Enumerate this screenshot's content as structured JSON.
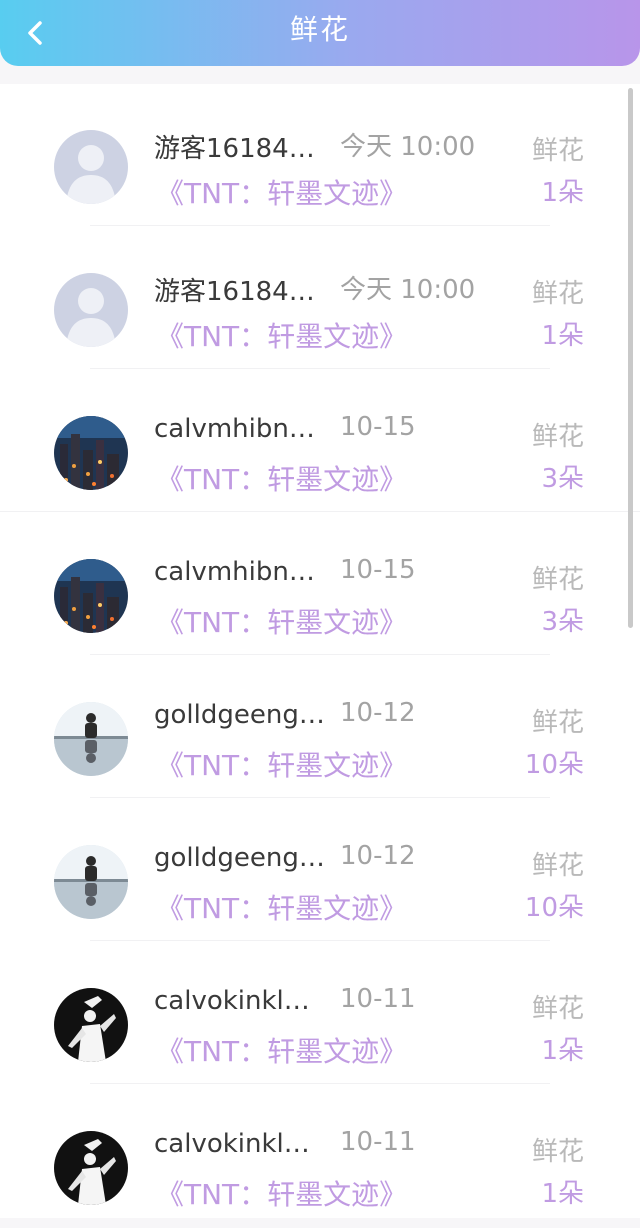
{
  "header": {
    "title": "鲜花",
    "back_icon": "chevron-left-icon"
  },
  "colors": {
    "accent": "#c09be2",
    "gradient_start": "#58cdf0",
    "gradient_end": "#b895ea"
  },
  "items": [
    {
      "name": "游客16184…",
      "time": "今天 10:00",
      "kind": "鲜花",
      "book": "《TNT：轩墨文迹》",
      "count": "1朵",
      "avatar": "default-avatar"
    },
    {
      "name": "游客16184…",
      "time": "今天 10:00",
      "kind": "鲜花",
      "book": "《TNT：轩墨文迹》",
      "count": "1朵",
      "avatar": "default-avatar"
    },
    {
      "name": "calvmhibn…",
      "time": "10-15",
      "kind": "鲜花",
      "book": "《TNT：轩墨文迹》",
      "count": "3朵",
      "avatar": "city-night-avatar"
    },
    {
      "name": "calvmhibn…",
      "time": "10-15",
      "kind": "鲜花",
      "book": "《TNT：轩墨文迹》",
      "count": "3朵",
      "avatar": "city-night-avatar"
    },
    {
      "name": "golldgeeng…",
      "time": "10-12",
      "kind": "鲜花",
      "book": "《TNT：轩墨文迹》",
      "count": "10朵",
      "avatar": "silhouette-window-avatar"
    },
    {
      "name": "golldgeeng…",
      "time": "10-12",
      "kind": "鲜花",
      "book": "《TNT：轩墨文迹》",
      "count": "10朵",
      "avatar": "silhouette-window-avatar"
    },
    {
      "name": "calvokinkl…",
      "time": "10-11",
      "kind": "鲜花",
      "book": "《TNT：轩墨文迹》",
      "count": "1朵",
      "avatar": "dancer-avatar"
    },
    {
      "name": "calvokinkl…",
      "time": "10-11",
      "kind": "鲜花",
      "book": "《TNT：轩墨文迹》",
      "count": "1朵",
      "avatar": "dancer-avatar"
    }
  ]
}
